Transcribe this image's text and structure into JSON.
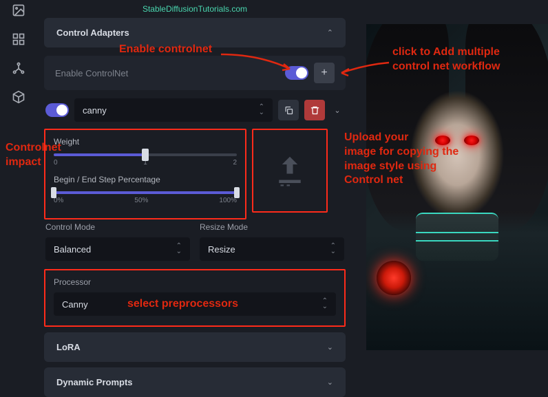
{
  "brand": "StableDiffusionTutorials.com",
  "panels": {
    "control_adapters": "Control Adapters",
    "lora": "LoRA",
    "dynamic_prompts": "Dynamic Prompts"
  },
  "enable_row": {
    "label": "Enable ControlNet"
  },
  "adapter": {
    "type": "canny",
    "weight_label": "Weight",
    "weight_ticks": [
      "0",
      "1",
      "2"
    ],
    "range_label": "Begin / End Step Percentage",
    "range_ticks": [
      "0%",
      "50%",
      "100%"
    ]
  },
  "control_mode": {
    "label": "Control Mode",
    "value": "Balanced"
  },
  "resize_mode": {
    "label": "Resize Mode",
    "value": "Resize"
  },
  "processor": {
    "label": "Processor",
    "value": "Canny"
  },
  "annotations": {
    "enable": "Enable controlnet",
    "add_multi": "click to Add multiple\ncontrol net workflow",
    "impact": "Controlnet\nimpact",
    "upload": "Upload your\nimage for copying the\nimage style using\nControl net",
    "preproc": "select preprocessors"
  }
}
